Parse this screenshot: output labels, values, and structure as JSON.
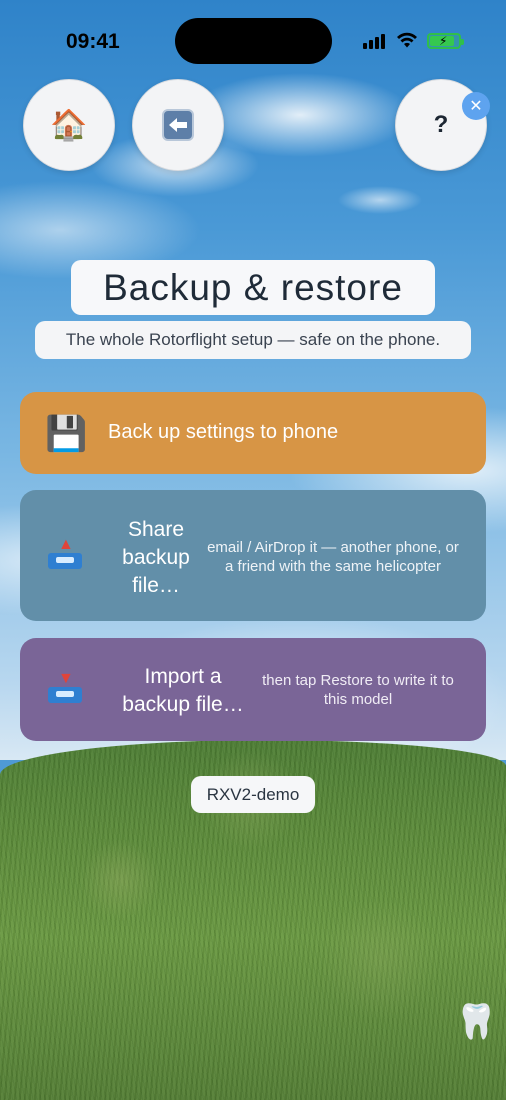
{
  "status_bar": {
    "time": "09:41"
  },
  "nav": {
    "home_icon": "🏠",
    "back_icon": "back-arrow-icon",
    "help_label": "?",
    "close_badge": "✕"
  },
  "header": {
    "title": "Backup & restore",
    "subtitle": "The whole Rotorflight setup — safe on the phone."
  },
  "actions": [
    {
      "icon": "💾",
      "label": "Back up settings to phone",
      "hint": "",
      "color": "#d79545"
    },
    {
      "icon": "📤",
      "label": "Share backup file…",
      "hint": "email / AirDrop it — another phone, or a friend with the same helicopter",
      "color": "#628fa9"
    },
    {
      "icon": "📥",
      "label": "Import a backup file…",
      "hint": "then tap Restore to write it to this model",
      "color": "#7a6597"
    }
  ],
  "model_name": "RXV2-demo",
  "corner_icon": "🦷"
}
